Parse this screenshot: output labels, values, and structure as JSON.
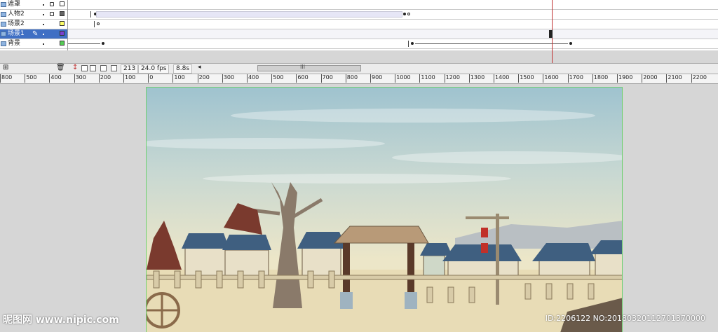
{
  "layers": [
    {
      "name": "遮罩",
      "swatch": "#ffffff",
      "locked": true
    },
    {
      "name": "人物2",
      "swatch": "#666666",
      "locked": true
    },
    {
      "name": "场景2",
      "swatch": "#ffff66",
      "locked": false
    },
    {
      "name": "场景1",
      "swatch": "#7a3fd0",
      "locked": false,
      "selected": true
    },
    {
      "name": "背景",
      "swatch": "#55cc55",
      "locked": false
    }
  ],
  "status": {
    "frame": "213",
    "fps": "24.0 fps",
    "time": "8.8s",
    "scroll_thumb": "III"
  },
  "ruler_ticks": [
    "800",
    "500",
    "400",
    "300",
    "200",
    "100",
    "0",
    "100",
    "200",
    "300",
    "400",
    "500",
    "600",
    "700",
    "800",
    "900",
    "1000",
    "1100",
    "1200",
    "1300",
    "1400",
    "1500",
    "1600",
    "1700",
    "1800",
    "1900",
    "2000",
    "2100",
    "2200"
  ],
  "watermark": {
    "site": "昵图网 www.nipic.com",
    "id": "ID:2206122 NO:20180320112701370000"
  },
  "colors": {
    "selected_layer": "#3f6fc4",
    "guide": "#6fd06f",
    "playhead": "#c03030"
  }
}
